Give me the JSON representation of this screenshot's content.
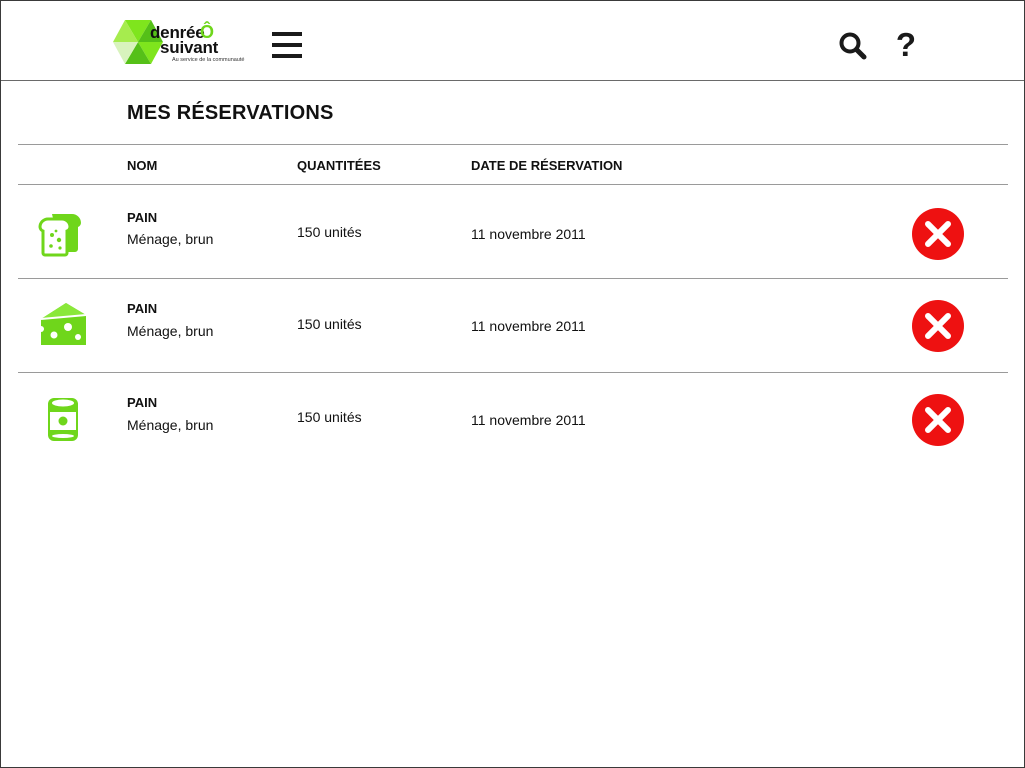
{
  "brand": {
    "name_line1": "denrée",
    "name_o": "Ô",
    "name_line2": "suivant",
    "tagline": "Au service de la communauté",
    "colors": {
      "light_green": "#a6ec4e",
      "mid_green": "#7fe51d",
      "dark_green": "#55c018",
      "pale_green": "#d8f3bd"
    }
  },
  "header": {
    "menu_icon": "hamburger-menu-icon",
    "search_icon": "search-icon",
    "help_label": "?"
  },
  "page": {
    "title": "MES RÉSERVATIONS"
  },
  "table": {
    "columns": {
      "name": "NOM",
      "quantity": "QUANTITÉES",
      "date": "DATE DE RÉSERVATION"
    },
    "rows": [
      {
        "icon": "bread-icon",
        "name": "PAIN",
        "description": "Ménage, brun",
        "quantity": "150 unités",
        "date": "11 novembre 2011"
      },
      {
        "icon": "cheese-icon",
        "name": "PAIN",
        "description": "Ménage, brun",
        "quantity": "150 unités",
        "date": "11 novembre 2011"
      },
      {
        "icon": "can-icon",
        "name": "PAIN",
        "description": "Ménage, brun",
        "quantity": "150 unités",
        "date": "11 novembre 2011"
      }
    ]
  },
  "colors": {
    "icon_green": "#6fd61b",
    "cancel_red": "#ee1111"
  }
}
